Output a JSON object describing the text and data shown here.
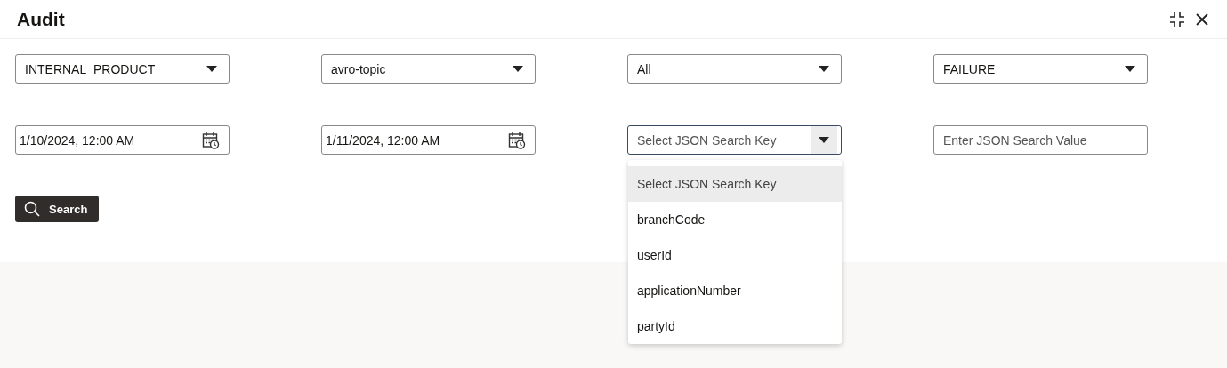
{
  "window": {
    "title": "Audit"
  },
  "filters": [
    {
      "kind": "select",
      "value": "INTERNAL_PRODUCT",
      "expanded": false
    },
    {
      "kind": "select",
      "value": "avro-topic",
      "expanded": false
    },
    {
      "kind": "select",
      "value": "All",
      "expanded": false
    },
    {
      "kind": "select",
      "value": "FAILURE",
      "expanded": false
    },
    {
      "kind": "date",
      "value": "1/10/2024, 12:00 AM"
    },
    {
      "kind": "date",
      "value": "1/11/2024, 12:00 AM"
    },
    {
      "kind": "select",
      "placeholder": "Select JSON Search Key",
      "expanded": true,
      "options": [
        {
          "label": "Select JSON Search Key",
          "selected": true
        },
        {
          "label": "branchCode",
          "selected": false
        },
        {
          "label": "userId",
          "selected": false
        },
        {
          "label": "applicationNumber",
          "selected": false
        },
        {
          "label": "partyId",
          "selected": false
        }
      ]
    },
    {
      "kind": "text",
      "placeholder": "Enter JSON Search Value"
    }
  ],
  "search_button": {
    "label": "Search"
  }
}
